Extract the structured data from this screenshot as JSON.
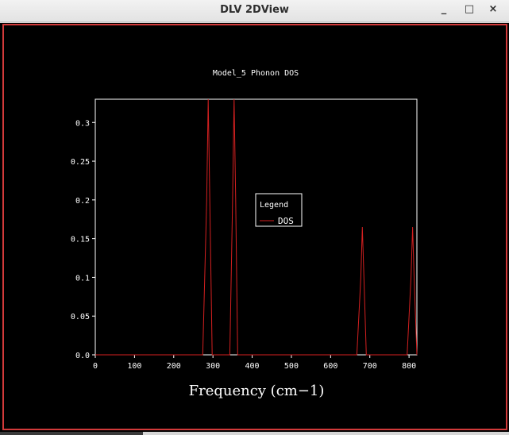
{
  "window": {
    "title": "DLV 2DView",
    "minimize_label": "_",
    "maximize_label": "□",
    "close_label": "×"
  },
  "colors": {
    "plot_background": "#000000",
    "axis": "#ffffff",
    "series": "#d42020",
    "frame_border": "#d23a3a"
  },
  "chart_data": {
    "type": "line",
    "title": "Model_5 Phonon DOS",
    "xlabel": "Frequency (cm−1)",
    "ylabel": "",
    "xlim": [
      0,
      820
    ],
    "ylim": [
      0,
      0.33
    ],
    "xticks": [
      0,
      100,
      200,
      300,
      400,
      500,
      600,
      700,
      800
    ],
    "xtick_labels": [
      "0",
      "100",
      "200",
      "300",
      "400",
      "500",
      "600",
      "700",
      "800"
    ],
    "yticks": [
      0.0,
      0.05,
      0.1,
      0.15,
      0.2,
      0.25,
      0.3
    ],
    "ytick_labels": [
      "0.0",
      "0.05",
      "0.1",
      "0.15",
      "0.2",
      "0.25",
      "0.3"
    ],
    "grid": false,
    "legend": {
      "title": "Legend",
      "position": "center"
    },
    "series": [
      {
        "name": "DOS",
        "color": "#d42020",
        "x": [
          0,
          274,
          284,
          288,
          292,
          298,
          343,
          350,
          354,
          358,
          363,
          667,
          677,
          681,
          685,
          691,
          795,
          805,
          809,
          813,
          820
        ],
        "y": [
          0,
          0,
          0.2,
          0.33,
          0.2,
          0,
          0,
          0.2,
          0.33,
          0.2,
          0,
          0,
          0.1,
          0.165,
          0.1,
          0,
          0,
          0.1,
          0.165,
          0.1,
          0
        ]
      }
    ]
  }
}
